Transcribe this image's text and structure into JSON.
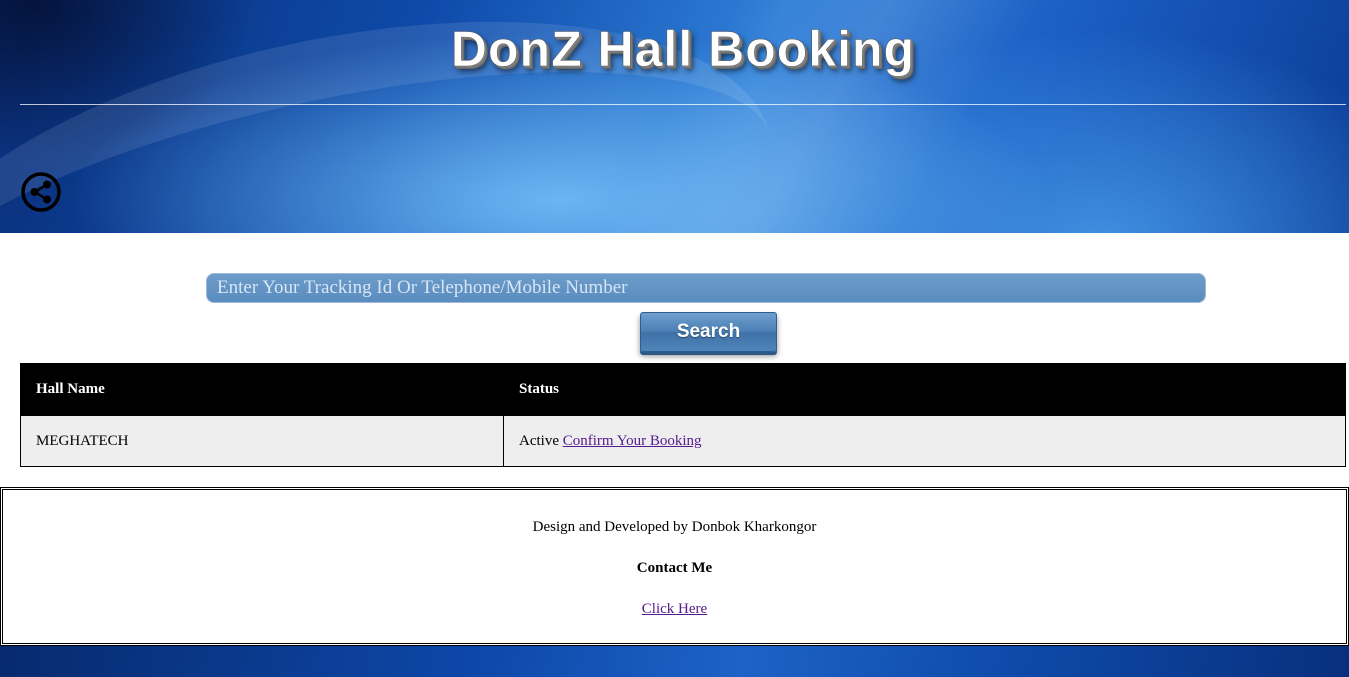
{
  "header": {
    "title": "DonZ Hall Booking",
    "share_icon": "share-icon"
  },
  "search": {
    "placeholder": "Enter Your Tracking Id Or Telephone/Mobile Number",
    "value": "",
    "button_label": "Search"
  },
  "table": {
    "columns": [
      "Hall Name",
      "Status"
    ],
    "rows": [
      {
        "hall_name": "MEGHATECH",
        "status": "Active",
        "action_link": "Confirm Your Booking"
      }
    ]
  },
  "footer": {
    "credit": "Design and Developed by Donbok Kharkongor",
    "contact_heading": "Contact Me",
    "contact_link": "Click Here"
  },
  "colors": {
    "header_blue": "#0e4aa9",
    "table_header_bg": "#000000",
    "table_row_bg": "#eeeeee",
    "link": "#551a8b",
    "search_button": "#4a7eb3"
  }
}
